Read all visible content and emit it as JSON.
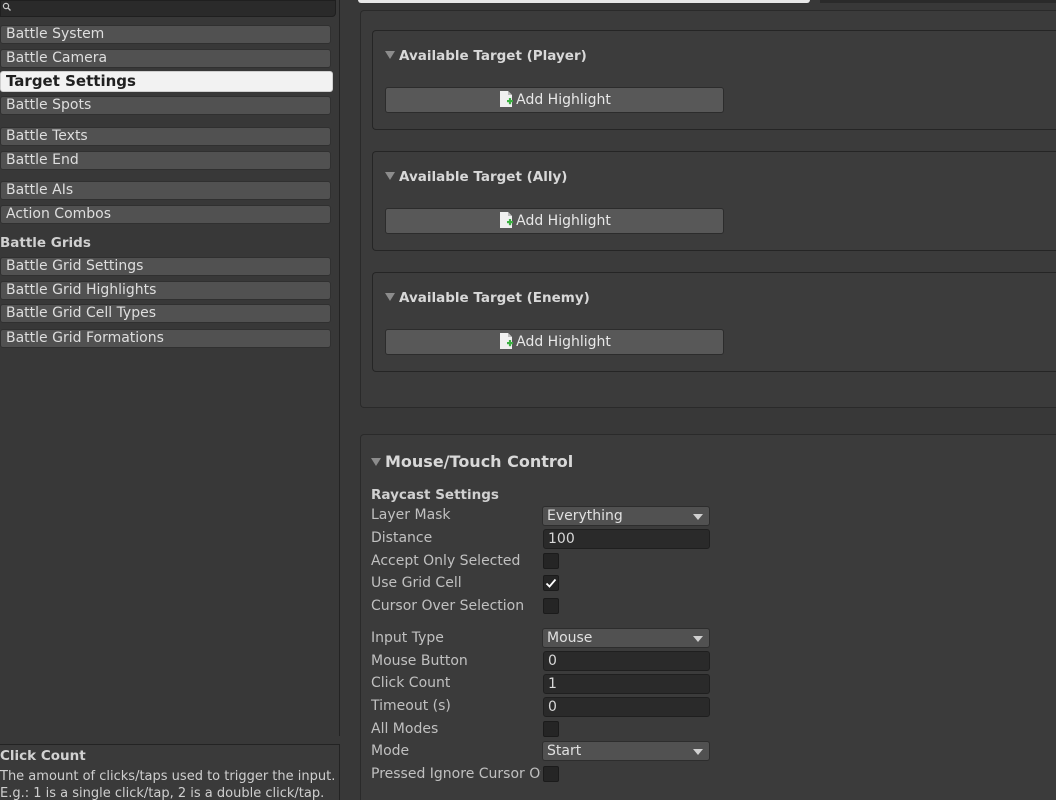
{
  "nav": {
    "items": [
      {
        "label": "Battle System",
        "selected": false
      },
      {
        "label": "Battle Camera",
        "selected": false
      },
      {
        "label": "Target Settings",
        "selected": true
      },
      {
        "label": "Battle Spots",
        "selected": false
      },
      {
        "label": "Battle Texts",
        "selected": false
      },
      {
        "label": "Battle End",
        "selected": false
      },
      {
        "label": "Battle AIs",
        "selected": false
      },
      {
        "label": "Action Combos",
        "selected": false
      }
    ],
    "section_title": "Battle Grids",
    "grid_items": [
      {
        "label": "Battle Grid Settings"
      },
      {
        "label": "Battle Grid Highlights"
      },
      {
        "label": "Battle Grid Cell Types"
      },
      {
        "label": "Battle Grid Formations"
      }
    ]
  },
  "help": {
    "title": "Click Count",
    "text": "The amount of clicks/taps used to trigger the input.\nE.g.: 1 is a single click/tap, 2 is a double click/tap."
  },
  "targets": [
    {
      "title": "Available Target (Player)",
      "button": "Add Highlight"
    },
    {
      "title": "Available Target (Ally)",
      "button": "Add Highlight"
    },
    {
      "title": "Available Target (Enemy)",
      "button": "Add Highlight"
    }
  ],
  "mouse": {
    "title": "Mouse/Touch Control",
    "raycast_title": "Raycast Settings",
    "layer_mask": {
      "label": "Layer Mask",
      "value": "Everything"
    },
    "distance": {
      "label": "Distance",
      "value": "100"
    },
    "accept_only_selected": {
      "label": "Accept Only Selected",
      "checked": false
    },
    "use_grid_cell": {
      "label": "Use Grid Cell",
      "checked": true
    },
    "cursor_over_selection": {
      "label": "Cursor Over Selection",
      "checked": false
    },
    "input_type": {
      "label": "Input Type",
      "value": "Mouse"
    },
    "mouse_button": {
      "label": "Mouse Button",
      "value": "0"
    },
    "click_count": {
      "label": "Click Count",
      "value": "1"
    },
    "timeout": {
      "label": "Timeout (s)",
      "value": "0"
    },
    "all_modes": {
      "label": "All Modes",
      "checked": false
    },
    "mode": {
      "label": "Mode",
      "value": "Start"
    },
    "pressed_ignore": {
      "label": "Pressed Ignore Cursor Over",
      "checked": false
    }
  },
  "colors": {
    "selected_bg": "#f2f2f2",
    "button_bg": "#515151",
    "panel_bg": "#383838",
    "check_accent": "#ffffff",
    "add_icon_green": "#3cb043"
  }
}
